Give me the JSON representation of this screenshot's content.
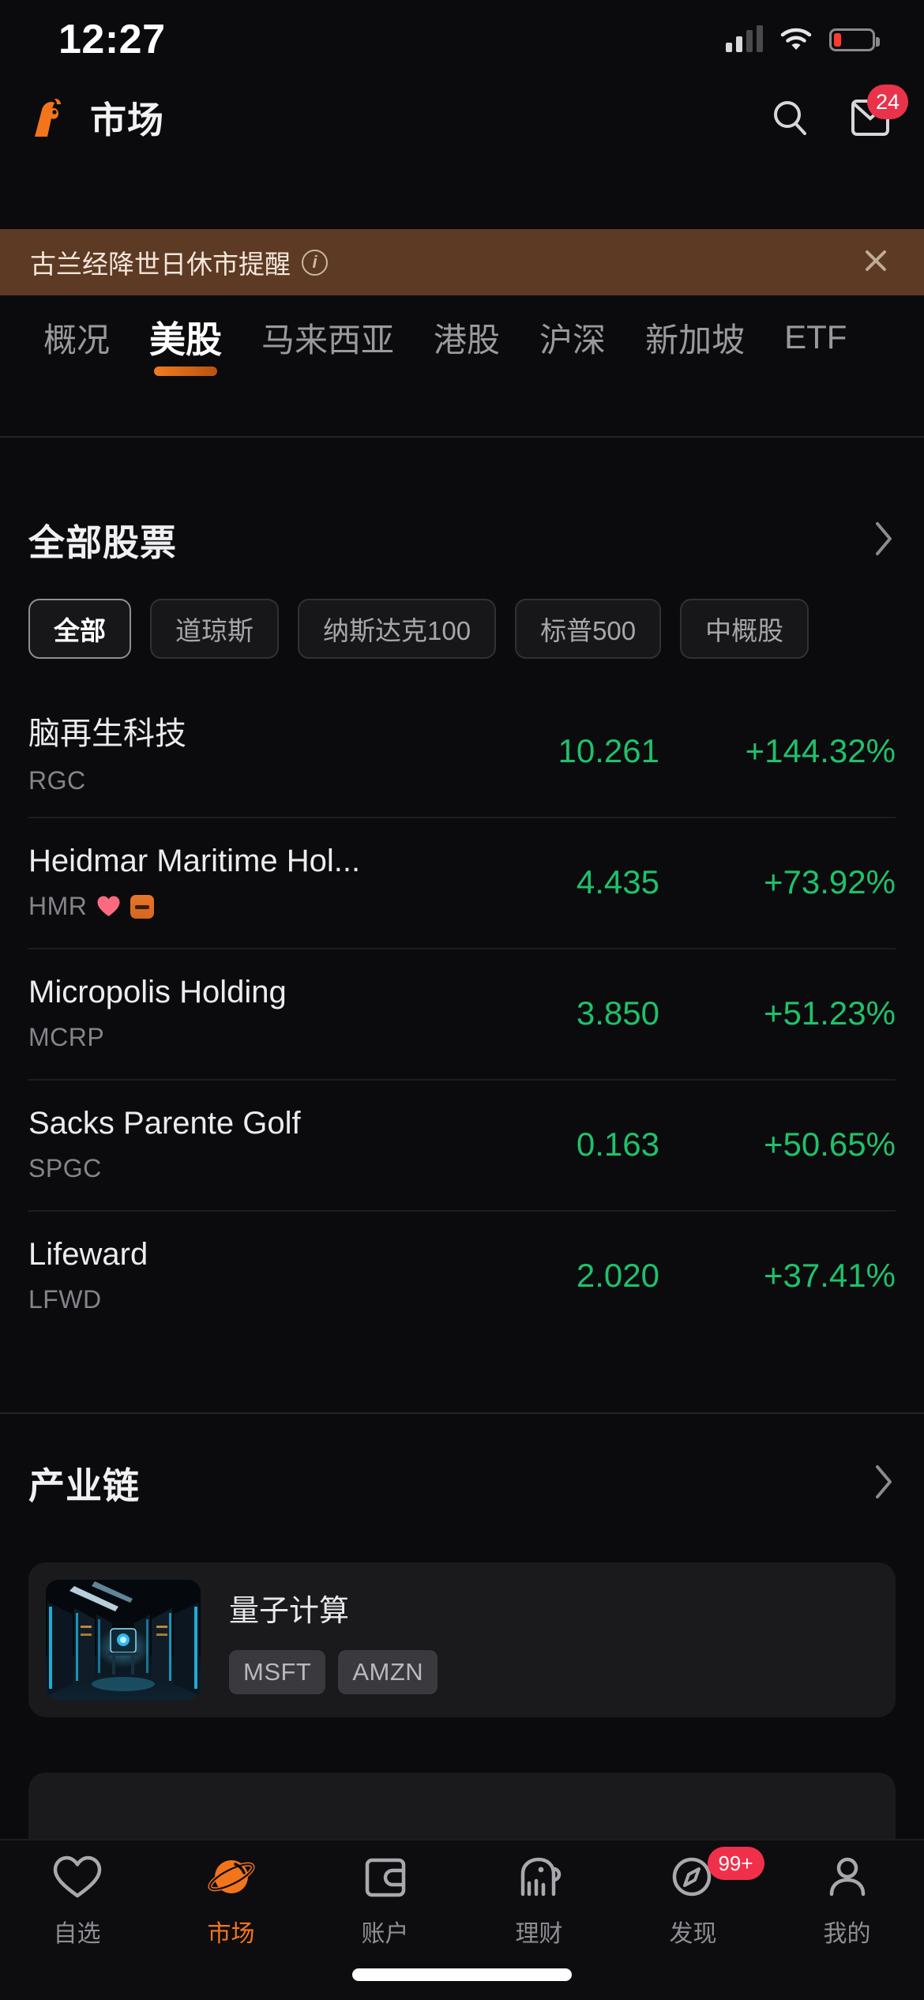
{
  "status_bar": {
    "time": "12:27",
    "icons": [
      "cellular-signal-icon",
      "wifi-icon",
      "battery-icon"
    ]
  },
  "header": {
    "logo": "moomoo-bull-logo",
    "title": "市场",
    "search_icon": "search-icon",
    "mail_icon": "mail-icon",
    "mail_badge": "24"
  },
  "notice": {
    "text": "古兰经降世日休市提醒",
    "info_icon": "info-icon",
    "close_icon": "close-icon",
    "background": "#5c3a24"
  },
  "market_tabs": [
    {
      "label": "概况",
      "active": false
    },
    {
      "label": "美股",
      "active": true
    },
    {
      "label": "马来西亚",
      "active": false
    },
    {
      "label": "港股",
      "active": false
    },
    {
      "label": "沪深",
      "active": false
    },
    {
      "label": "新加坡",
      "active": false
    },
    {
      "label": "ETF",
      "active": false
    }
  ],
  "all_stocks": {
    "title": "全部股票",
    "more_icon": "chevron-right-icon",
    "filters": [
      {
        "label": "全部",
        "selected": true
      },
      {
        "label": "道琼斯",
        "selected": false
      },
      {
        "label": "纳斯达克100",
        "selected": false
      },
      {
        "label": "标普500",
        "selected": false
      },
      {
        "label": "中概股",
        "selected": false
      }
    ],
    "rows": [
      {
        "name": "脑再生科技",
        "code": "RGC",
        "price": "10.261",
        "change": "+144.32%",
        "badges": []
      },
      {
        "name": "Heidmar Maritime Hol...",
        "code": "HMR",
        "price": "4.435",
        "change": "+73.92%",
        "badges": [
          "heart-icon",
          "card-icon"
        ]
      },
      {
        "name": "Micropolis Holding",
        "code": "MCRP",
        "price": "3.850",
        "change": "+51.23%",
        "badges": []
      },
      {
        "name": "Sacks Parente Golf",
        "code": "SPGC",
        "price": "0.163",
        "change": "+50.65%",
        "badges": []
      },
      {
        "name": "Lifeward",
        "code": "LFWD",
        "price": "2.020",
        "change": "+37.41%",
        "badges": []
      }
    ],
    "up_color": "#1fc16b"
  },
  "industry_chain": {
    "title": "产业链",
    "more_icon": "chevron-right-icon",
    "cards": [
      {
        "title": "量子计算",
        "image": "data-center-photo",
        "tags": [
          "MSFT",
          "AMZN"
        ]
      }
    ]
  },
  "bottom_nav": {
    "items": [
      {
        "label": "自选",
        "icon": "heart-icon",
        "active": false,
        "badge": ""
      },
      {
        "label": "市场",
        "icon": "planet-icon",
        "active": true,
        "badge": ""
      },
      {
        "label": "账户",
        "icon": "wallet-icon",
        "active": false,
        "badge": ""
      },
      {
        "label": "理财",
        "icon": "piggy-bank-icon",
        "active": false,
        "badge": ""
      },
      {
        "label": "发现",
        "icon": "compass-icon",
        "active": false,
        "badge": "99+"
      },
      {
        "label": "我的",
        "icon": "person-icon",
        "active": false,
        "badge": ""
      }
    ],
    "active_color": "#f2751c"
  }
}
